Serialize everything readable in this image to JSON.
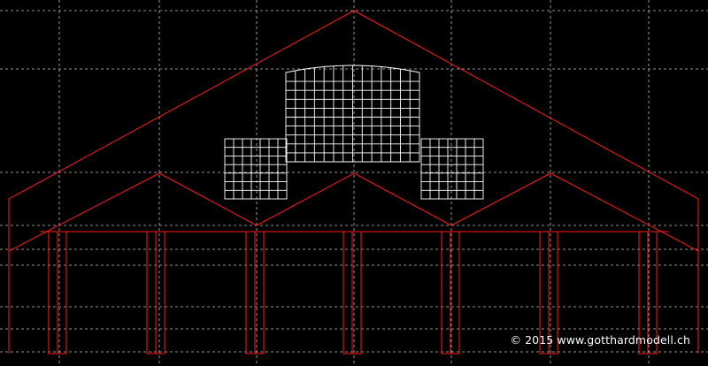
{
  "copyright": "© 2015 www.gotthardmodell.ch",
  "colors": {
    "background": "#000000",
    "outline": "#ff1a1a",
    "window_grid": "#ffffff",
    "construction_lines": "#bfbfbf"
  }
}
